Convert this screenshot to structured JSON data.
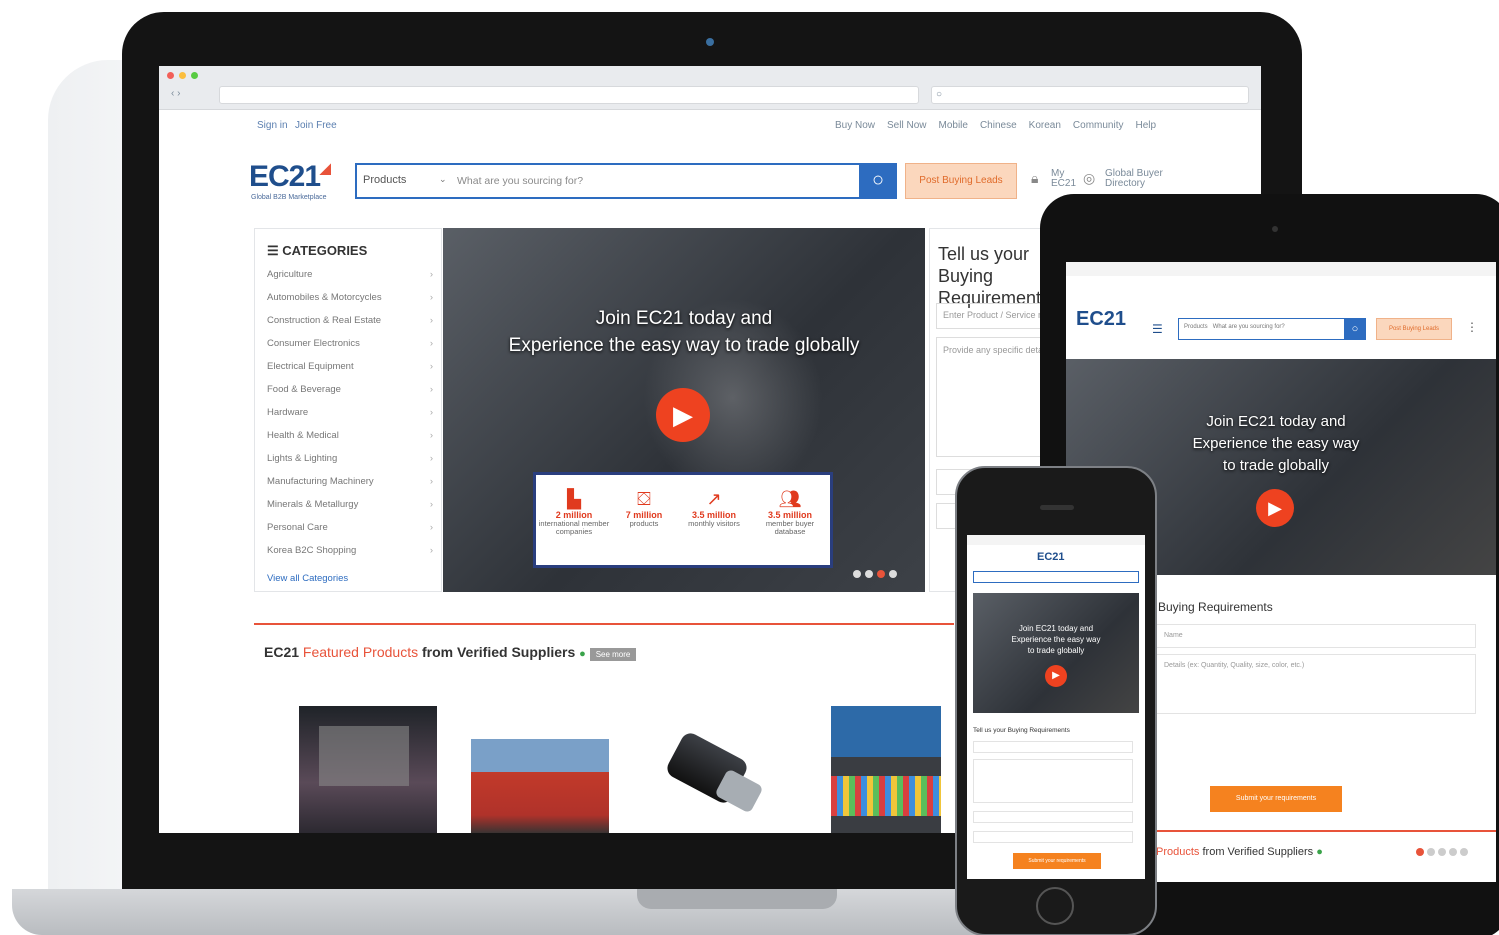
{
  "laptop": {
    "toplinks": {
      "signin": "Sign in",
      "join": "Join Free",
      "right": [
        "Buy Now",
        "Sell Now",
        "Mobile",
        "Chinese",
        "Korean",
        "Community",
        "Help"
      ]
    },
    "logo": {
      "text": "EC21",
      "tagline": "Global B2B Marketplace"
    },
    "search": {
      "category": "Products",
      "placeholder": "What are you sourcing for?",
      "post_label": "Post Buying Leads"
    },
    "header_links": {
      "my_ec21": "My EC21",
      "buyer_directory": "Global Buyer Directory"
    },
    "categories": {
      "title": "CATEGORIES",
      "items": [
        "Agriculture",
        "Automobiles & Motorcycles",
        "Construction & Real Estate",
        "Consumer Electronics",
        "Electrical Equipment",
        "Food & Beverage",
        "Hardware",
        "Health & Medical",
        "Lights & Lighting",
        "Manufacturing Machinery",
        "Minerals & Metallurgy",
        "Personal Care",
        "Korea B2C Shopping"
      ],
      "view_all": "View all Categories"
    },
    "hero": {
      "line1": "Join EC21 today and",
      "line2": "Experience the easy way to trade globally",
      "stats": [
        {
          "icon": "building-icon",
          "value": "2 million",
          "label": "international member companies"
        },
        {
          "icon": "box-icon",
          "value": "7 million",
          "label": "products"
        },
        {
          "icon": "trend-icon",
          "value": "3.5 million",
          "label": "monthly visitors"
        },
        {
          "icon": "people-icon",
          "value": "3.5 million",
          "label": "member buyer database"
        }
      ]
    },
    "tell_us": {
      "title": "Tell us your Buying Requirements",
      "product_placeholder": "Enter Product / Service name",
      "detail_placeholder": "Provide any specific details, Quantity, size, color, etc."
    },
    "featured": {
      "prefix": "EC21",
      "highlight": "Featured Products",
      "suffix": "from Verified Suppliers",
      "more": "See more"
    }
  },
  "tablet": {
    "hero_lines": [
      "Join EC21 today and",
      "Experience the easy way",
      "to trade globally"
    ],
    "buying_title": "Buying Requirements",
    "name_placeholder": "Name",
    "detail_placeholder": "Details (ex: Quantity, Quality, size, color, etc.)",
    "submit_label": "Submit your requirements",
    "featured": {
      "highlight": "Products",
      "suffix": "from Verified Suppliers"
    }
  },
  "phone": {
    "hero_lines": [
      "Join EC21 today and",
      "Experience the easy way",
      "to trade globally"
    ],
    "buying_title": "Tell us your Buying Requirements",
    "submit_label": "Submit your requirements"
  },
  "colors": {
    "brand_blue": "#1f4e8c",
    "accent_orange": "#f5821f",
    "accent_red": "#e8533a"
  }
}
